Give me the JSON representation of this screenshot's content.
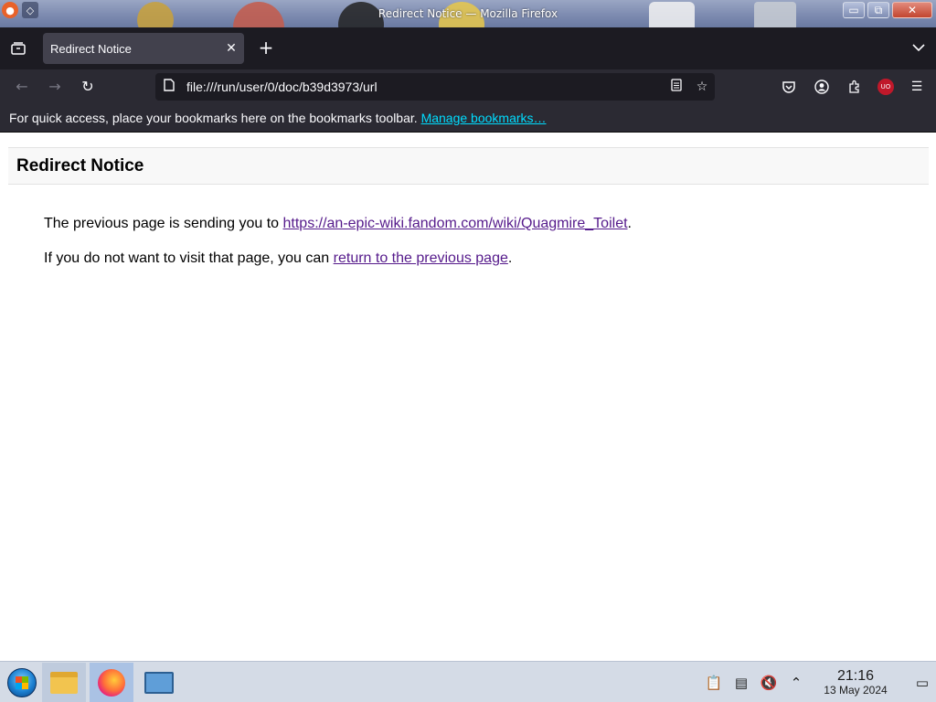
{
  "window": {
    "title": "Redirect Notice — Mozilla Firefox",
    "minimize_glyph": "▭",
    "maximize_glyph": "⧉",
    "close_glyph": "✕"
  },
  "tabs": {
    "active_label": "Redirect Notice",
    "close_glyph": "✕",
    "new_tab_glyph": "+",
    "list_glyph": "⌄"
  },
  "navbar": {
    "back_glyph": "←",
    "forward_glyph": "→",
    "reload_glyph": "↻",
    "url": "file:///run/user/0/doc/b39d3973/url"
  },
  "bookmarks_bar": {
    "message": "For quick access, place your bookmarks here on the bookmarks toolbar. ",
    "manage_link": "Manage bookmarks…"
  },
  "page": {
    "heading": "Redirect Notice",
    "line1_prefix": "The previous page is sending you to ",
    "line1_link": "https://an-epic-wiki.fandom.com/wiki/Quagmire_Toilet",
    "line1_suffix": ".",
    "line2_prefix": "If you do not want to visit that page, you can ",
    "line2_link": "return to the previous page",
    "line2_suffix": "."
  },
  "taskbar": {
    "clock_time": "21:16",
    "clock_date": "13 May 2024",
    "ublock_badge": "UO"
  },
  "colors": {
    "toolbar_bg": "#2b2a33",
    "tabstrip_bg": "#1c1b22",
    "bookmark_link": "#00ddff",
    "visited_link": "#551a8b"
  }
}
